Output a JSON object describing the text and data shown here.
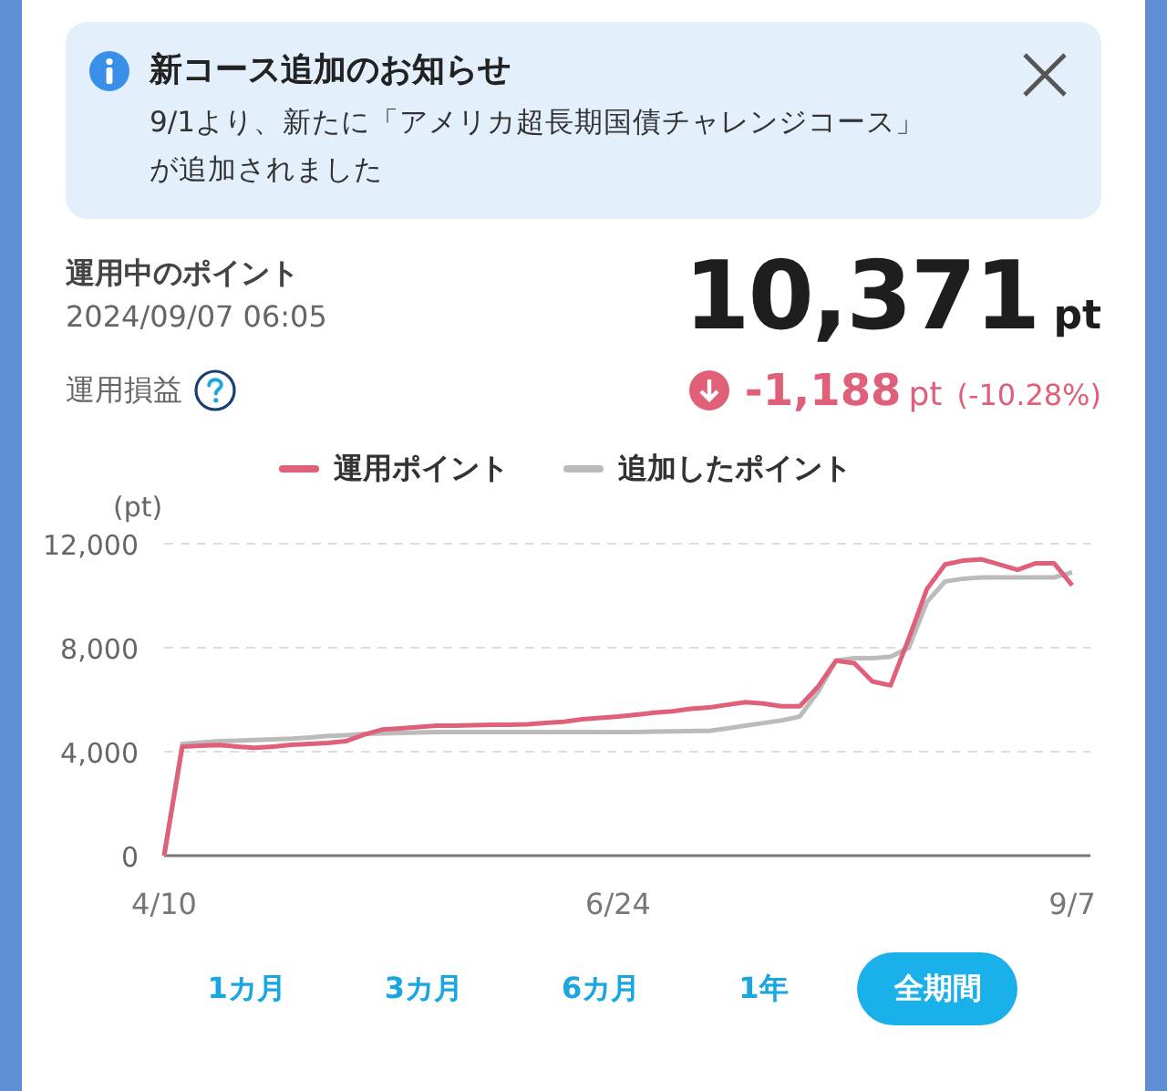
{
  "notice": {
    "title": "新コース追加のお知らせ",
    "body": "9/1より、新たに「アメリカ超長期国債チャレンジコース」が追加されました"
  },
  "summary": {
    "label": "運用中のポイント",
    "timestamp": "2024/09/07 06:05",
    "points": "10,371",
    "points_unit": "pt",
    "pl_label": "運用損益",
    "pl_value": "-1,188",
    "pl_unit": "pt",
    "pl_percent": "(-10.28%)"
  },
  "chart": {
    "chart_data": {
      "type": "line",
      "ylabel": "(pt)",
      "ylim": [
        0,
        12000
      ],
      "yticks": [
        {
          "value": 0,
          "label": "0"
        },
        {
          "value": 4000,
          "label": "4,000"
        },
        {
          "value": 8000,
          "label": "8,000"
        },
        {
          "value": 12000,
          "label": "12,000"
        }
      ],
      "categories": [
        "4/10",
        null,
        null,
        null,
        null,
        null,
        null,
        null,
        null,
        null,
        null,
        null,
        null,
        null,
        null,
        null,
        null,
        null,
        null,
        null,
        null,
        null,
        null,
        null,
        null,
        "6/24",
        null,
        null,
        null,
        null,
        null,
        null,
        null,
        null,
        null,
        null,
        null,
        null,
        null,
        null,
        null,
        null,
        null,
        null,
        null,
        null,
        null,
        null,
        null,
        null,
        "9/7"
      ],
      "series": [
        {
          "name": "運用ポイント",
          "color": "#e0607a",
          "values": [
            0,
            4200,
            4230,
            4250,
            4200,
            4150,
            4200,
            4260,
            4300,
            4340,
            4400,
            4650,
            4850,
            4900,
            4950,
            5000,
            5000,
            5020,
            5030,
            5040,
            5050,
            5100,
            5150,
            5250,
            5300,
            5350,
            5420,
            5500,
            5550,
            5650,
            5700,
            5800,
            5900,
            5850,
            5750,
            5750,
            6500,
            7500,
            7400,
            6700,
            6550,
            8350,
            10250,
            11200,
            11350,
            11400,
            11200,
            11000,
            11250,
            11250,
            10400
          ]
        },
        {
          "name": "追加したポイント",
          "color": "#bbbbbb",
          "values": [
            0,
            4300,
            4350,
            4400,
            4420,
            4450,
            4480,
            4500,
            4550,
            4600,
            4630,
            4680,
            4700,
            4720,
            4740,
            4750,
            4750,
            4750,
            4750,
            4750,
            4750,
            4750,
            4750,
            4750,
            4750,
            4750,
            4760,
            4770,
            4780,
            4790,
            4800,
            4900,
            5000,
            5100,
            5200,
            5350,
            6300,
            7500,
            7600,
            7600,
            7650,
            8000,
            9750,
            10550,
            10650,
            10700,
            10700,
            10700,
            10700,
            10700,
            10900
          ]
        }
      ]
    }
  },
  "periods": [
    {
      "label": "1カ月",
      "selected": false
    },
    {
      "label": "3カ月",
      "selected": false
    },
    {
      "label": "6カ月",
      "selected": false
    },
    {
      "label": "1年",
      "selected": false
    },
    {
      "label": "全期間",
      "selected": true
    }
  ]
}
